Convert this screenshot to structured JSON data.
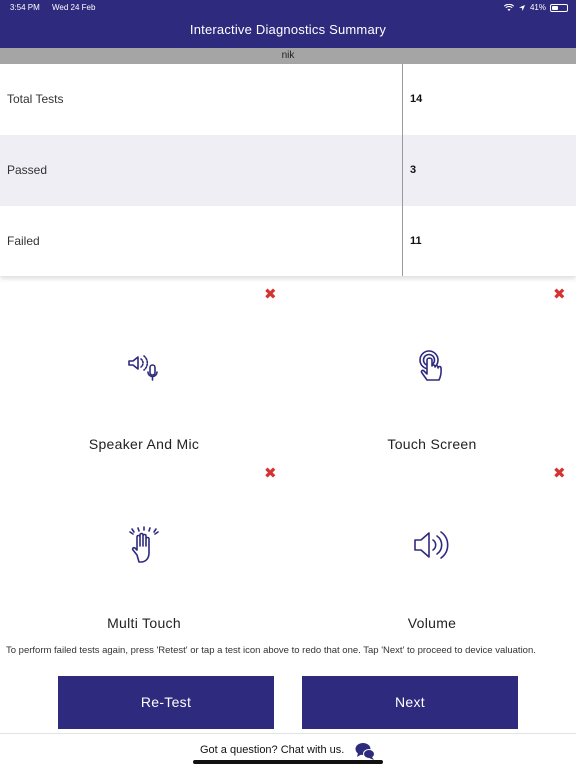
{
  "status_bar": {
    "time": "3:54 PM",
    "date": "Wed 24 Feb",
    "battery": "41%",
    "battery_level": 0.41
  },
  "header": {
    "title": "Interactive Diagnostics Summary"
  },
  "user": {
    "name": "nik"
  },
  "summary": {
    "rows": [
      {
        "label": "Total Tests",
        "value": "14"
      },
      {
        "label": "Passed",
        "value": "3"
      },
      {
        "label": "Failed",
        "value": "11"
      }
    ]
  },
  "tests": [
    {
      "label": "Speaker And Mic",
      "status": "failed",
      "icon": "speaker-mic-icon"
    },
    {
      "label": "Touch Screen",
      "status": "failed",
      "icon": "touch-screen-icon"
    },
    {
      "label": "Multi Touch",
      "status": "failed",
      "icon": "multi-touch-icon"
    },
    {
      "label": "Volume",
      "status": "failed",
      "icon": "volume-icon"
    }
  ],
  "fail_mark": "✖",
  "instructions": "To perform failed tests again, press 'Retest' or tap a test icon above to redo that one. Tap 'Next' to proceed to device valuation.",
  "buttons": {
    "retest": "Re-Test",
    "next": "Next"
  },
  "footer": {
    "chat_text": "Got a question? Chat with us."
  },
  "colors": {
    "primary": "#2e2a7e",
    "fail": "#d53232",
    "row_alt": "#efeef4",
    "user_bar": "#a5a5a5"
  }
}
